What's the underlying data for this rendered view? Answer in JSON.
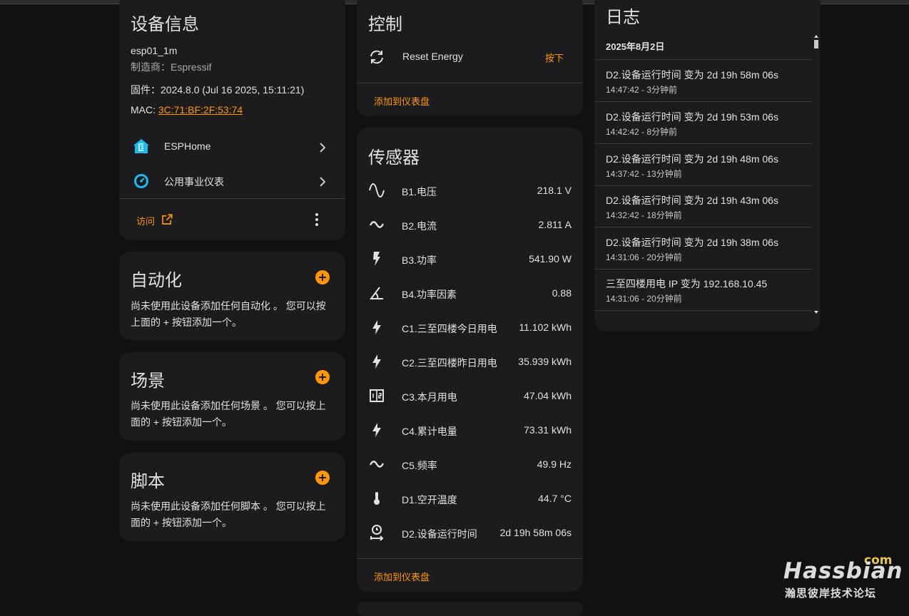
{
  "device_info": {
    "title": "设备信息",
    "model": "esp01_1m",
    "manufacturer": "制造商：Espressif",
    "firmware": "固件：2024.8.0 (Jul 16 2025, 15:11:21)",
    "mac_label": "MAC: ",
    "mac": "3C:71:BF:2F:53:74",
    "integrations": [
      {
        "label": "ESPHome",
        "icon": "esphome-icon"
      },
      {
        "label": "公用事业仪表",
        "icon": "utility-meter-icon"
      }
    ],
    "visit_label": "访问"
  },
  "automation": {
    "title": "自动化",
    "desc1": "尚未使用此设备添加任何自动化 。 您可以按",
    "desc2": "上面的 + 按钮添加一个。"
  },
  "scene": {
    "title": "场景",
    "desc1": "尚未使用此设备添加任何场景 。 您可以按上",
    "desc2": "面的 + 按钮添加一个。"
  },
  "script": {
    "title": "脚本",
    "desc1": "尚未使用此设备添加任何脚本 。 您可以按上",
    "desc2": "面的 + 按钮添加一个。"
  },
  "controls": {
    "title": "控制",
    "items": [
      {
        "name": "Reset Energy",
        "action": "按下",
        "icon": "restart-icon"
      }
    ],
    "add_label": "添加到仪表盘"
  },
  "sensors": {
    "title": "传感器",
    "items": [
      {
        "name": "B1.电压",
        "value": "218.1 V",
        "icon": "sine-wave-icon"
      },
      {
        "name": "B2.电流",
        "value": "2.811 A",
        "icon": "current-ac-icon"
      },
      {
        "name": "B3.功率",
        "value": "541.90 W",
        "icon": "flash-icon"
      },
      {
        "name": "B4.功率因素",
        "value": "0.88",
        "icon": "angle-icon"
      },
      {
        "name": "C1.三至四楼今日用电",
        "value": "11.102 kWh",
        "icon": "lightning-icon"
      },
      {
        "name": "C2.三至四楼昨日用电",
        "value": "35.939 kWh",
        "icon": "lightning-icon"
      },
      {
        "name": "C3.本月用电",
        "value": "47.04 kWh",
        "icon": "meter-icon"
      },
      {
        "name": "C4.累计电量",
        "value": "73.31 kWh",
        "icon": "flash-icon"
      },
      {
        "name": "C5.频率",
        "value": "49.9 Hz",
        "icon": "current-ac-icon"
      },
      {
        "name": "D1.空开温度",
        "value": "44.7 °C",
        "icon": "thermometer-icon"
      },
      {
        "name": "D2.设备运行时间",
        "value": "2d 19h 58m 06s",
        "icon": "timer-icon"
      }
    ],
    "add_label": "添加到仪表盘"
  },
  "logbook": {
    "title": "日志",
    "date": "2025年8月2日",
    "entries": [
      {
        "message": "D2.设备运行时间 变为 2d 19h 58m 06s",
        "time": "14:47:42 - 3分钟前"
      },
      {
        "message": "D2.设备运行时间 变为 2d 19h 53m 06s",
        "time": "14:42:42 - 8分钟前"
      },
      {
        "message": "D2.设备运行时间 变为 2d 19h 48m 06s",
        "time": "14:37:42 - 13分钟前"
      },
      {
        "message": "D2.设备运行时间 变为 2d 19h 43m 06s",
        "time": "14:32:42 - 18分钟前"
      },
      {
        "message": "D2.设备运行时间 变为 2d 19h 38m 06s",
        "time": "14:31:06 - 20分钟前"
      },
      {
        "message": "三至四楼用电 IP 变为 192.168.10.45",
        "time": "14:31:06 - 20分钟前"
      }
    ]
  },
  "watermark": {
    "brand": "Hassbian",
    "tld": "com",
    "subtitle": "瀚思彼岸技术论坛"
  },
  "colors": {
    "accent": "#ff9800",
    "card": "#1c1c1e",
    "background": "#111112",
    "esphome": "#18bcf2"
  }
}
